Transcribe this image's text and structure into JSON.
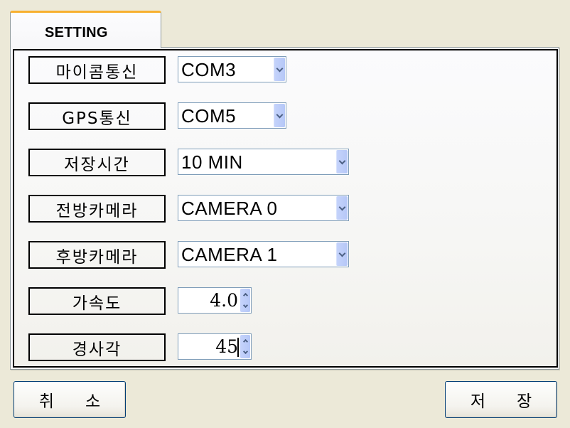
{
  "tab": {
    "label": "SETTING"
  },
  "settings": [
    {
      "label": "마이콤통신",
      "control": "combo",
      "size": "short",
      "value": "COM3"
    },
    {
      "label": "GPS통신",
      "control": "combo",
      "size": "short",
      "value": "COM5"
    },
    {
      "label": "저장시간",
      "control": "combo",
      "size": "long",
      "value": "10 MIN"
    },
    {
      "label": "전방카메라",
      "control": "combo",
      "size": "long",
      "value": "CAMERA 0"
    },
    {
      "label": "후방카메라",
      "control": "combo",
      "size": "long",
      "value": "CAMERA 1"
    },
    {
      "label": "가속도",
      "control": "spinner",
      "value": "4.0"
    },
    {
      "label": "경사각",
      "control": "spinner",
      "value": "45"
    }
  ],
  "buttons": {
    "cancel": {
      "char1": "취",
      "char2": "소"
    },
    "save": {
      "char1": "저",
      "char2": "장"
    }
  },
  "colors": {
    "tab_accent": "#f8b030",
    "window_bg": "#ece9d8",
    "input_border": "#7f9db9",
    "dropdown_button": "#c5d3fb",
    "button_border": "#003c74"
  }
}
